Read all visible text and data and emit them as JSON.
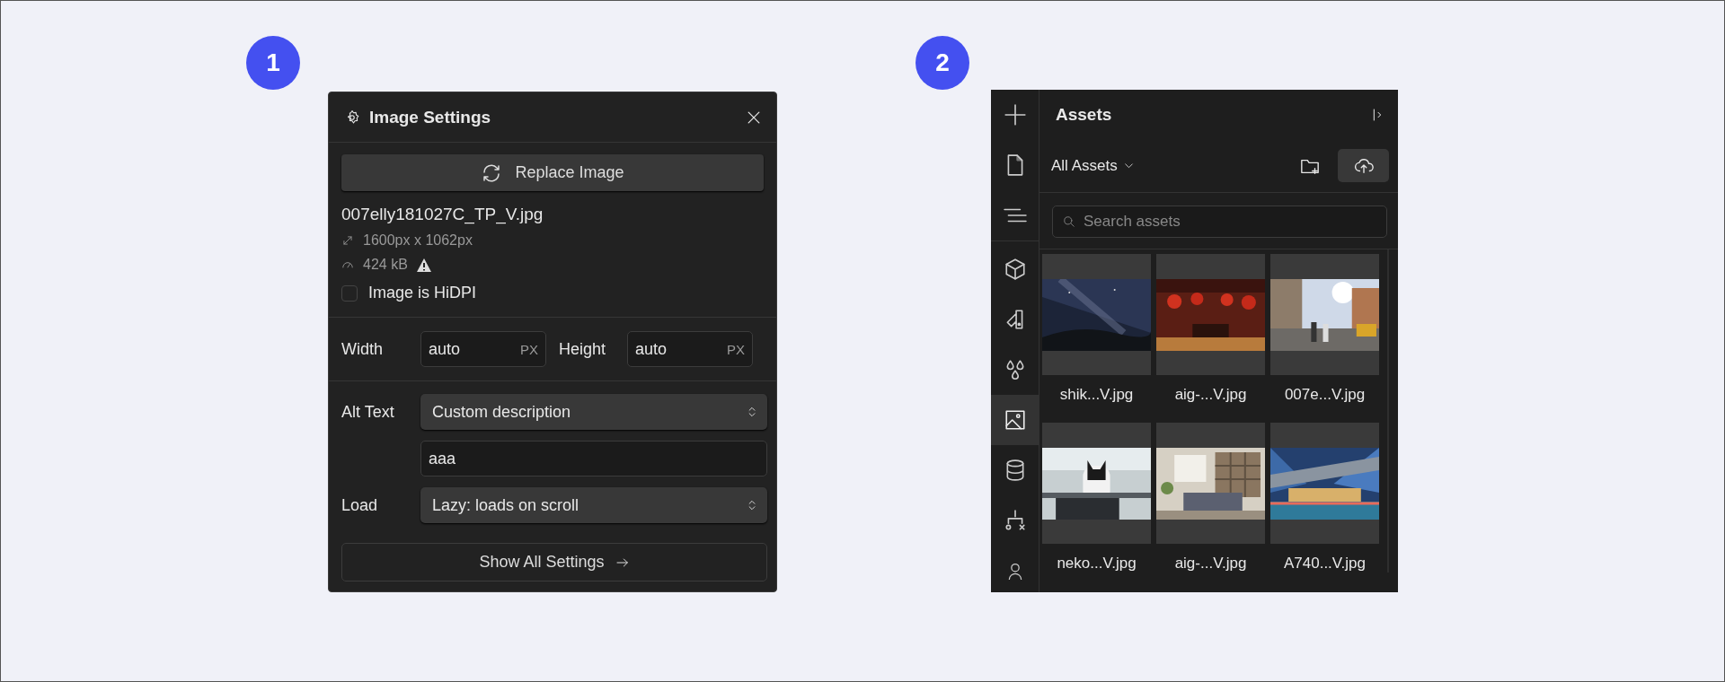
{
  "badges": [
    "1",
    "2"
  ],
  "image_settings": {
    "title": "Image Settings",
    "replace_button": "Replace Image",
    "file_name": "007elly181027C_TP_V.jpg",
    "dimensions": "1600px x 1062px",
    "file_size": "424 kB",
    "size_warning": true,
    "hidpi": {
      "label": "Image is HiDPI",
      "checked": false
    },
    "width": {
      "label": "Width",
      "value": "auto",
      "unit": "PX"
    },
    "height": {
      "label": "Height",
      "value": "auto",
      "unit": "PX"
    },
    "alt_text": {
      "label": "Alt Text",
      "mode": "Custom description",
      "value": "aaa"
    },
    "load": {
      "label": "Load",
      "value": "Lazy: loads on scroll"
    },
    "show_all_button": "Show All Settings"
  },
  "assets_panel": {
    "rail": [
      {
        "kind": "add",
        "selected": false
      },
      {
        "kind": "pages",
        "selected": false
      },
      {
        "kind": "navigator",
        "selected": false
      },
      {
        "kind": "components",
        "selected": false
      },
      {
        "kind": "styles",
        "selected": false
      },
      {
        "kind": "variables",
        "selected": false
      },
      {
        "kind": "assets",
        "selected": true
      },
      {
        "kind": "cms",
        "selected": false
      },
      {
        "kind": "logic",
        "selected": false
      },
      {
        "kind": "users",
        "selected": false
      }
    ],
    "title": "Assets",
    "filter": "All Assets",
    "search": {
      "placeholder": "Search assets"
    },
    "assets": [
      {
        "name": "shik...V.jpg",
        "kind": "picture"
      },
      {
        "name": "aig-...V.jpg",
        "kind": "picture"
      },
      {
        "name": "007e...V.jpg",
        "kind": "picture"
      },
      {
        "name": "neko...V.jpg",
        "kind": "picture"
      },
      {
        "name": "aig-...V.jpg",
        "kind": "picture"
      },
      {
        "name": "A740...V.jpg",
        "kind": "picture"
      }
    ]
  }
}
